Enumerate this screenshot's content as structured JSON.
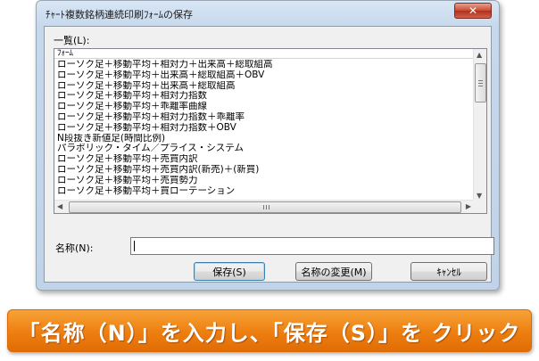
{
  "window": {
    "title": "ﾁｬｰﾄ複数銘柄連続印刷ﾌｫｰﾑの保存",
    "close_glyph": "✕"
  },
  "list": {
    "label": "一覧(L):",
    "column_header": "ﾌｫｰﾑ",
    "items": [
      "ローソク足＋移動平均＋相対力＋出来高＋総取組高",
      "ローソク足＋移動平均＋出来高＋総取組高＋OBV",
      "ローソク足＋移動平均＋出来高＋総取組高",
      "ローソク足＋移動平均＋相対力指数",
      "ローソク足＋移動平均＋乖離率曲線",
      "ローソク足＋移動平均＋相対力指数＋乖離率",
      "ローソク足＋移動平均＋相対力指数＋OBV",
      "N段抜き新値足(時間比例)",
      "パラボリック・タイム／プライス・システム",
      "ローソク足＋移動平均＋売買内訳",
      "ローソク足＋移動平均＋売買内訳(新売)＋(新買)",
      "ローソク足＋移動平均＋売買勢力",
      "ローソク足＋移動平均＋買ローテーション"
    ]
  },
  "name_field": {
    "label": "名称(N):",
    "value": ""
  },
  "buttons": {
    "save": "保存(S)",
    "rename": "名称の変更(M)",
    "cancel": "ｷｬﾝｾﾙ"
  },
  "instruction": {
    "text": "「名称（N）」を入力し、「保存（S）」を クリック"
  }
}
